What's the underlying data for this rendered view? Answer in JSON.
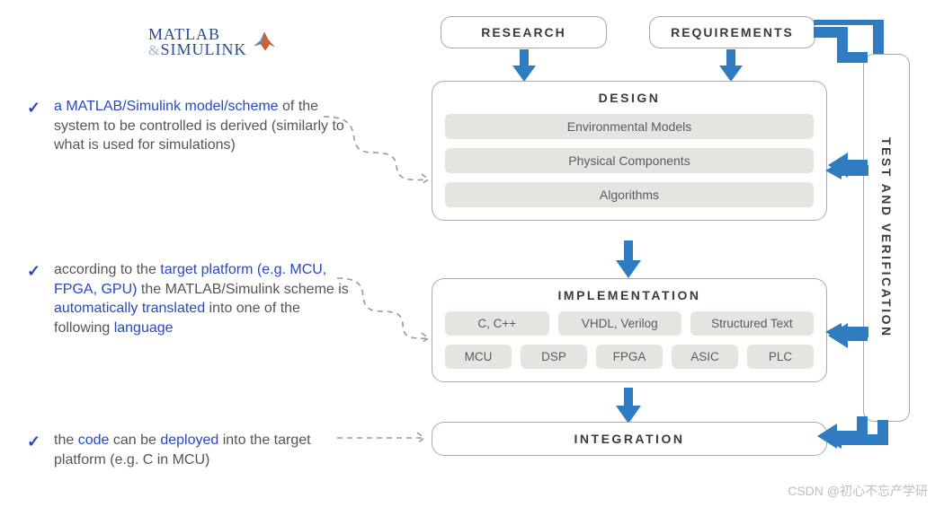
{
  "logo": {
    "line1": "MATLAB",
    "amp": "&",
    "line2": "SIMULINK"
  },
  "bullet1": {
    "highlight": "a MATLAB/Simulink model/scheme",
    "rest": " of the system to be controlled is derived (similarly to what is used for simulations)"
  },
  "bullet2": {
    "p1": "according to the ",
    "h1": "target platform (e.g. MCU, FPGA, GPU)",
    "p2": " the MATLAB/Simulink scheme is ",
    "h2": "automatically translated",
    "p3": " into one of the following ",
    "h3": "language"
  },
  "bullet3": {
    "p1": "the ",
    "h1": "code",
    "p2": " can be ",
    "h2": "deployed",
    "p3": " into the target platform (e.g. C in MCU)"
  },
  "flow": {
    "research": "RESEARCH",
    "requirements": "REQUIREMENTS",
    "design": {
      "title": "DESIGN",
      "items": [
        "Environmental Models",
        "Physical Components",
        "Algorithms"
      ]
    },
    "implementation": {
      "title": "IMPLEMENTATION",
      "row1": [
        "C, C++",
        "VHDL, Verilog",
        "Structured Text"
      ],
      "row2": [
        "MCU",
        "DSP",
        "FPGA",
        "ASIC",
        "PLC"
      ]
    },
    "integration": "INTEGRATION",
    "verification": "TEST AND VERIFICATION"
  },
  "watermark": "CSDN @初心不忘产学研"
}
